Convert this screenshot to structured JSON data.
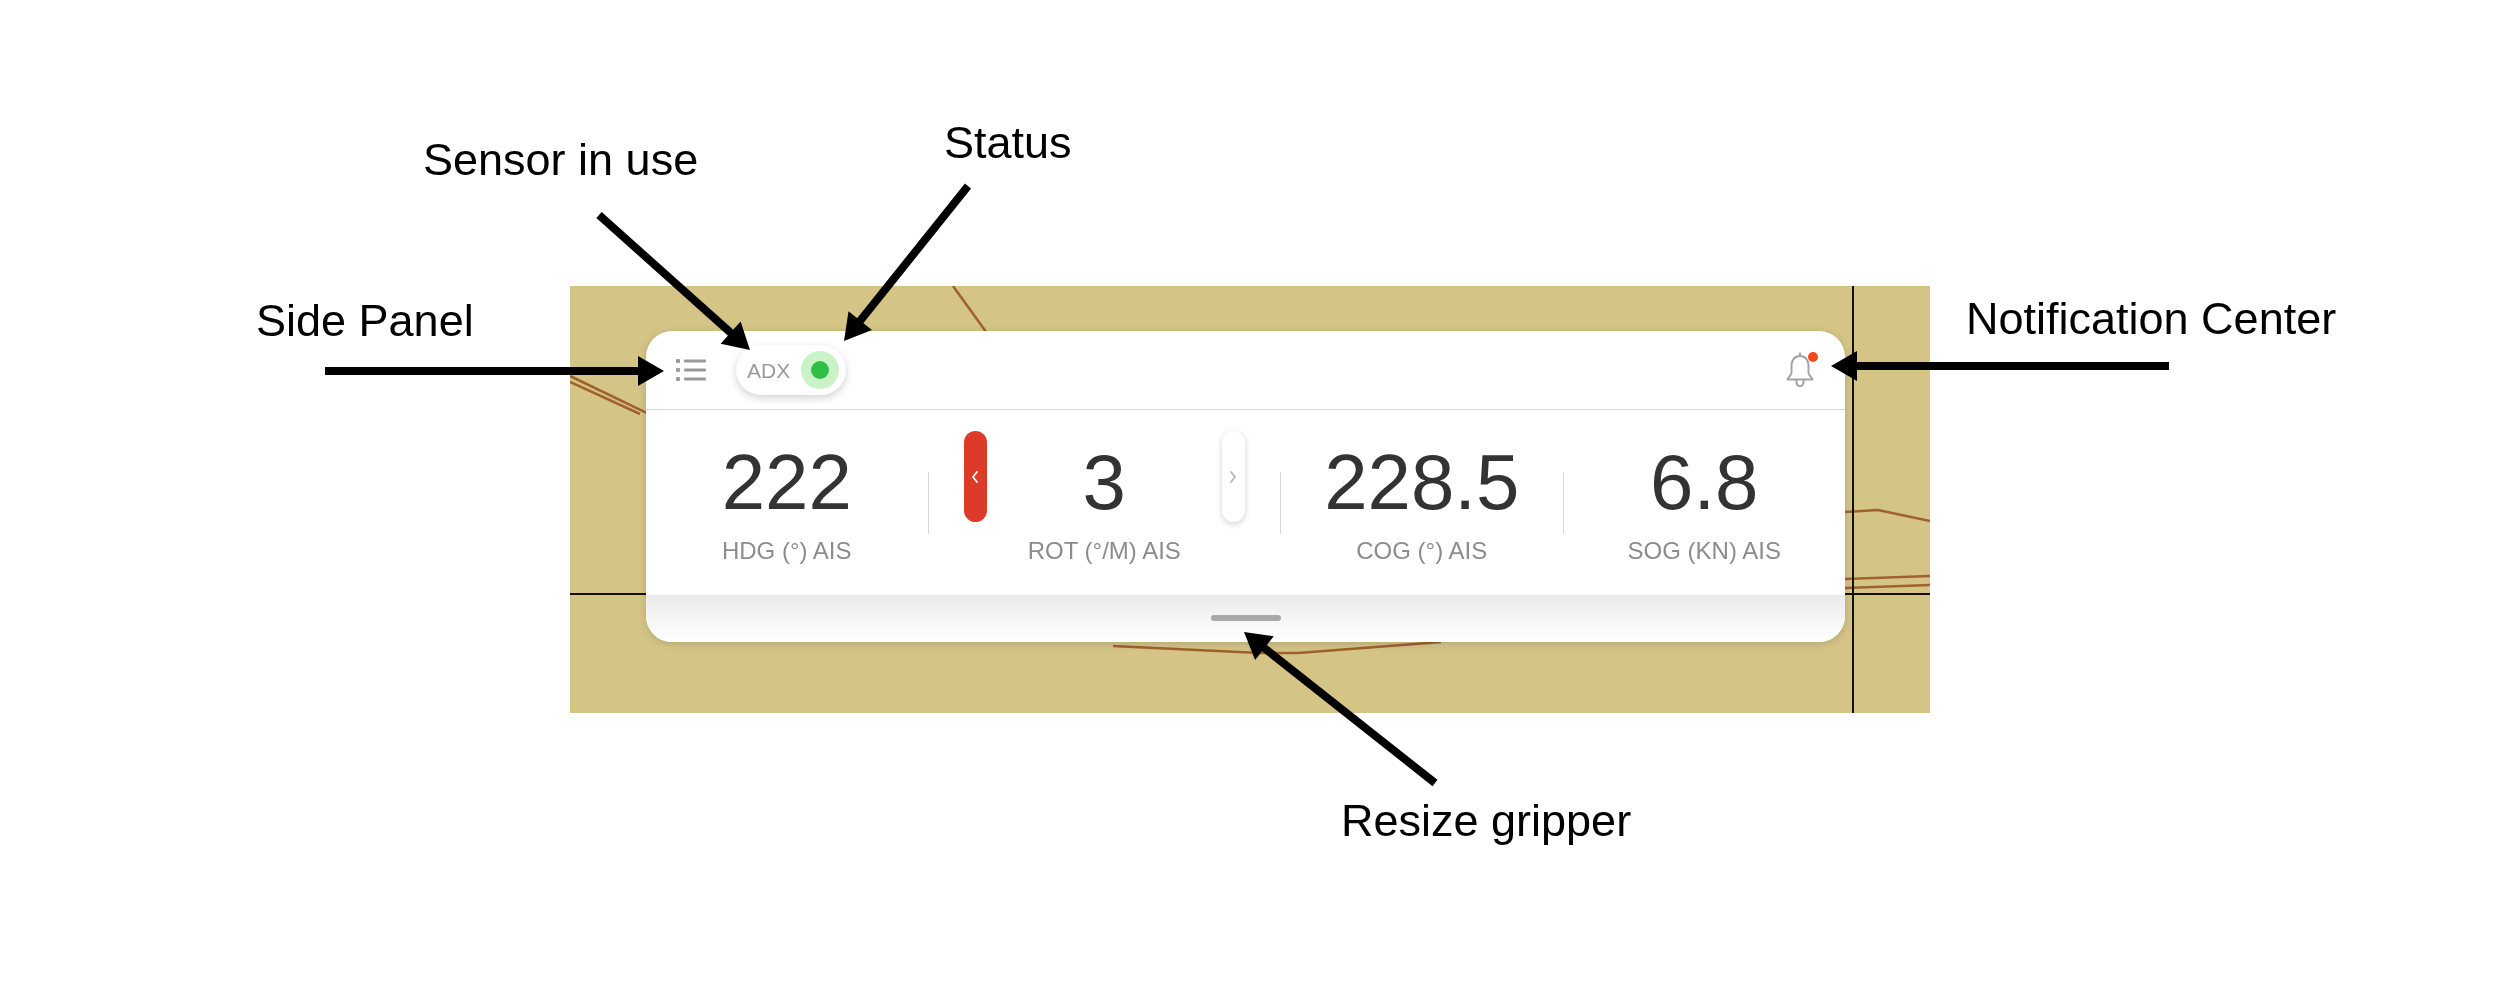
{
  "annotations": [
    {
      "label": "Sensor in use"
    },
    {
      "label": "Status"
    },
    {
      "label": "Side Panel"
    },
    {
      "label": "Notification Center"
    },
    {
      "label": "Resize gripper"
    }
  ],
  "widget": {
    "header": {
      "sensor": {
        "label": "ADX",
        "online": true
      },
      "notifications": {
        "unread": true
      }
    },
    "metrics": [
      {
        "kind": "plain",
        "value": "222",
        "label": "HDG (°) AIS"
      },
      {
        "kind": "stepper",
        "value": "3",
        "label": "ROT (°/M) AIS",
        "buttons": [
          {
            "kind": "left",
            "active": true
          },
          {
            "kind": "right",
            "active": false
          }
        ]
      },
      {
        "kind": "plain",
        "value": "228.5",
        "label": "COG (°) AIS"
      },
      {
        "kind": "plain",
        "value": "6.8",
        "label": "SOG (KN) AIS"
      }
    ]
  }
}
